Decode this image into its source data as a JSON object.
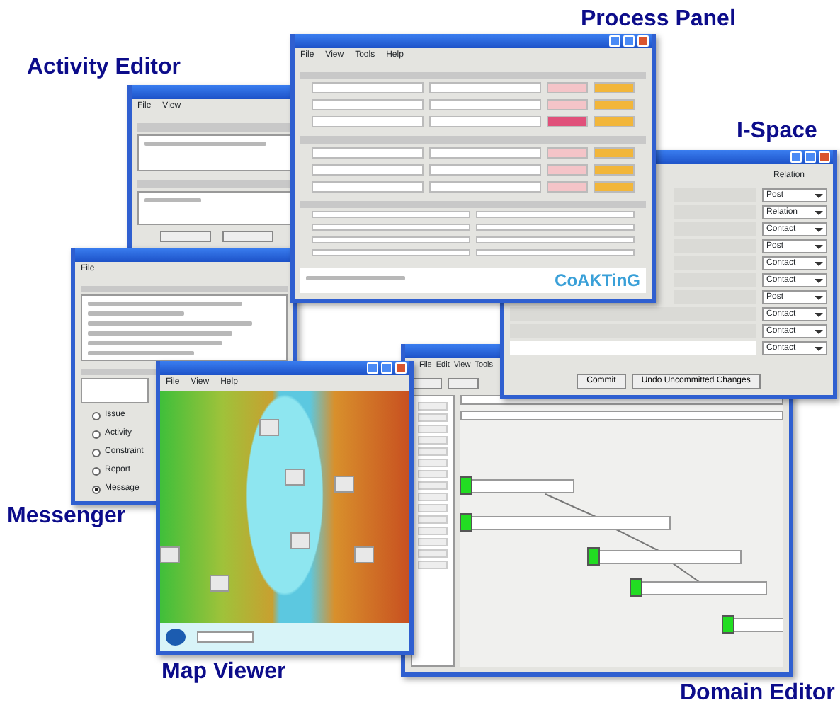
{
  "windows": [
    {
      "kind": "activity",
      "caption": "Activity Editor",
      "menu": [
        "File",
        "View"
      ]
    },
    {
      "kind": "messenger",
      "caption": "Messenger",
      "menu": [
        "File"
      ],
      "message_types": [
        {
          "label": "Issue",
          "selected": false
        },
        {
          "label": "Activity",
          "selected": false
        },
        {
          "label": "Constraint",
          "selected": false
        },
        {
          "label": "Report",
          "selected": false
        },
        {
          "label": "Message",
          "selected": true
        }
      ]
    },
    {
      "kind": "domain",
      "caption": "Domain Editor",
      "menu": [
        "File",
        "Edit",
        "View",
        "Tools"
      ]
    },
    {
      "kind": "ispace",
      "caption": "I-Space",
      "column_header": "Relation",
      "relations": [
        "Post",
        "Relation",
        "Contact",
        "Post",
        "Contact",
        "Contact",
        "Post",
        "Contact",
        "Contact",
        "Contact"
      ],
      "buttons": [
        "Commit",
        "Undo Uncommitted Changes"
      ]
    },
    {
      "kind": "process",
      "caption": "Process Panel",
      "menu": [
        "File",
        "View",
        "Tools",
        "Help"
      ],
      "logo": "CoAKTinG"
    },
    {
      "kind": "map",
      "caption": "Map Viewer",
      "menu": [
        "File",
        "View",
        "Help"
      ]
    }
  ]
}
